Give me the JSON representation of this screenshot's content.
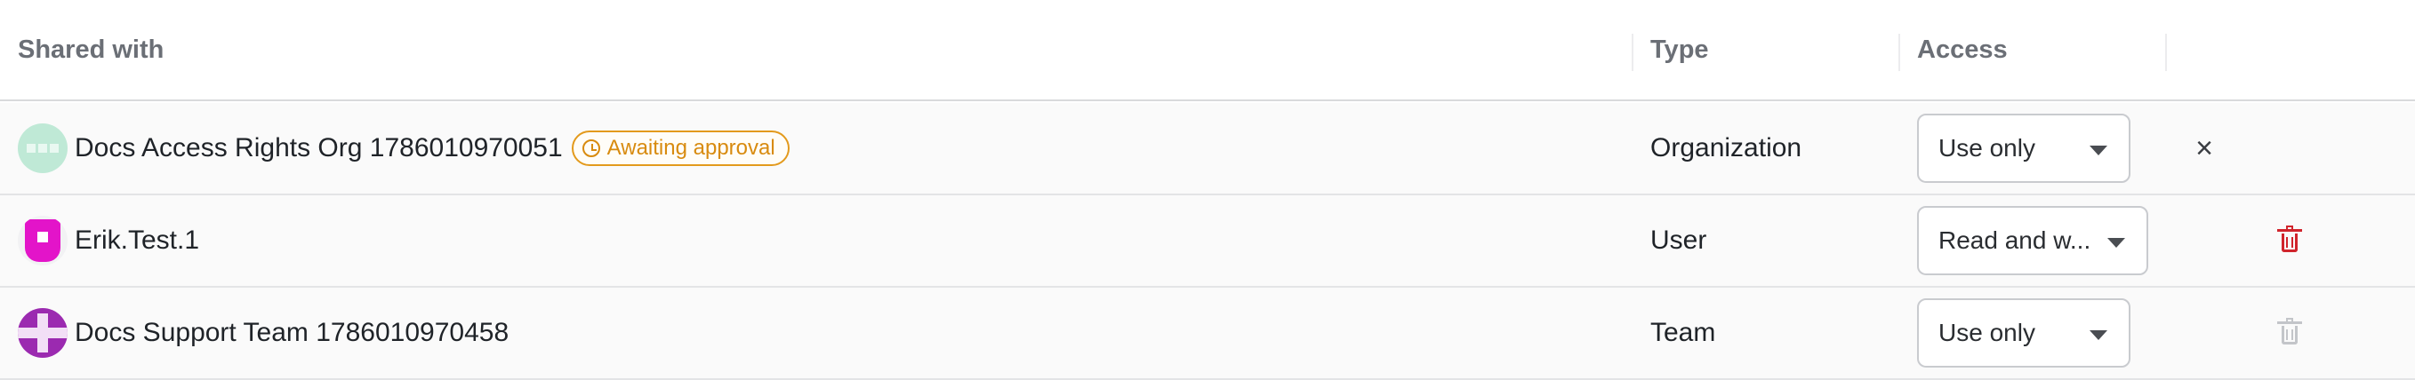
{
  "table": {
    "columns": {
      "shared_with": "Shared with",
      "type": "Type",
      "access": "Access"
    },
    "rows": [
      {
        "name": "Docs Access Rights Org 1786010970051",
        "avatar": "org-avatar",
        "badge": "Awaiting approval",
        "type": "Organization",
        "access": "Use only",
        "action": "remove-x"
      },
      {
        "name": "Erik.Test.1",
        "avatar": "user-avatar",
        "badge": "",
        "type": "User",
        "access": "Read and w...",
        "action": "delete-trash"
      },
      {
        "name": "Docs Support Team 1786010970458",
        "avatar": "team-avatar",
        "badge": "",
        "type": "Team",
        "access": "Use only",
        "action": "delete-trash-disabled"
      }
    ]
  },
  "colors": {
    "badge": "#d88b0f",
    "delete_active": "#d0242c",
    "delete_disabled": "#c3c5c9",
    "header_text": "#6b6f76"
  }
}
